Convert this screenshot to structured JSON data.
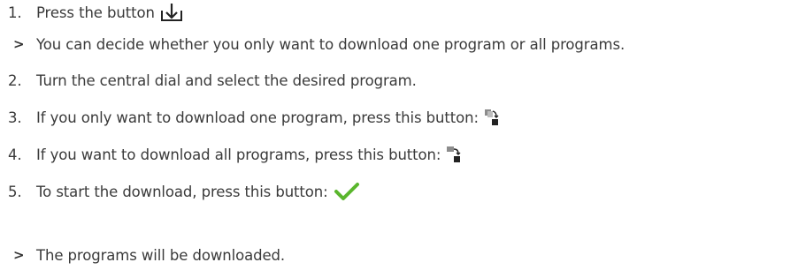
{
  "steps": [
    {
      "kind": "number",
      "marker": "1.",
      "text": "Press the button",
      "icon": "download-icon"
    },
    {
      "kind": "result",
      "marker": ">",
      "text": "You can decide whether you only want to download one program or all programs."
    },
    {
      "kind": "number",
      "marker": "2.",
      "text": "Turn the central dial and select the desired program."
    },
    {
      "kind": "number",
      "marker": "3.",
      "text": "If you only want to download one program, press this button:",
      "icon": "download-single-program-icon"
    },
    {
      "kind": "number",
      "marker": "4.",
      "text": "If you want to download all programs, press this button:",
      "icon": "download-all-programs-icon"
    },
    {
      "kind": "number",
      "marker": "5.",
      "text": "To start the download, press this button:",
      "icon": "checkmark-icon"
    },
    {
      "kind": "result",
      "marker": ">",
      "text": "The programs will be downloaded."
    }
  ],
  "colors": {
    "text": "#3a3a3a",
    "checkmark": "#5ab62d",
    "icon_dark": "#222222",
    "icon_grey": "#8c8c8c"
  }
}
